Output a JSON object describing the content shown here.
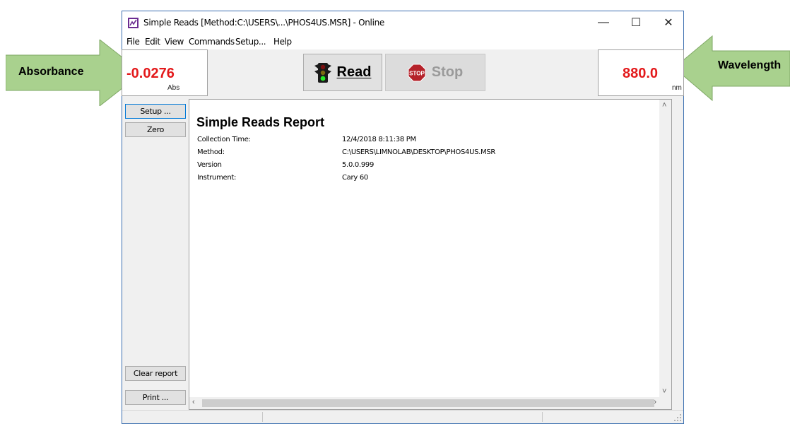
{
  "callouts": {
    "absorbance_label": "Absorbance",
    "wavelength_label": "Wavelength",
    "arrow_color": "#a9d18e"
  },
  "window": {
    "title": "Simple Reads [Method:C:\\USERS\\...\\PHOS4US.MSR] - Online",
    "controls": {
      "minimize": "—",
      "maximize": "☐",
      "close": "✕"
    }
  },
  "menu": {
    "items": [
      "File",
      "Edit",
      "View",
      "Commands",
      "Setup...",
      "Help"
    ]
  },
  "readouts": {
    "absorbance": {
      "value": "-0.0276",
      "unit": "Abs"
    },
    "wavelength": {
      "value": "880.0",
      "unit": "nm"
    },
    "value_color": "#e3191b"
  },
  "toolbar": {
    "read_label": "Read",
    "stop_label": "Stop",
    "stop_icon_text": "STOP"
  },
  "sidebar": {
    "setup_label": "Setup ...",
    "zero_label": "Zero",
    "clear_label": "Clear report",
    "print_label": "Print ..."
  },
  "report": {
    "title": "Simple Reads Report",
    "rows": [
      {
        "label": "Collection Time:",
        "value": "12/4/2018 8:11:38 PM"
      },
      {
        "label": "Method:",
        "value": "C:\\USERS\\LIMNOLAB\\DESKTOP\\PHOS4US.MSR"
      },
      {
        "label": "Version",
        "value": "5.0.0.999"
      },
      {
        "label": "Instrument:",
        "value": "Cary 60"
      }
    ]
  }
}
